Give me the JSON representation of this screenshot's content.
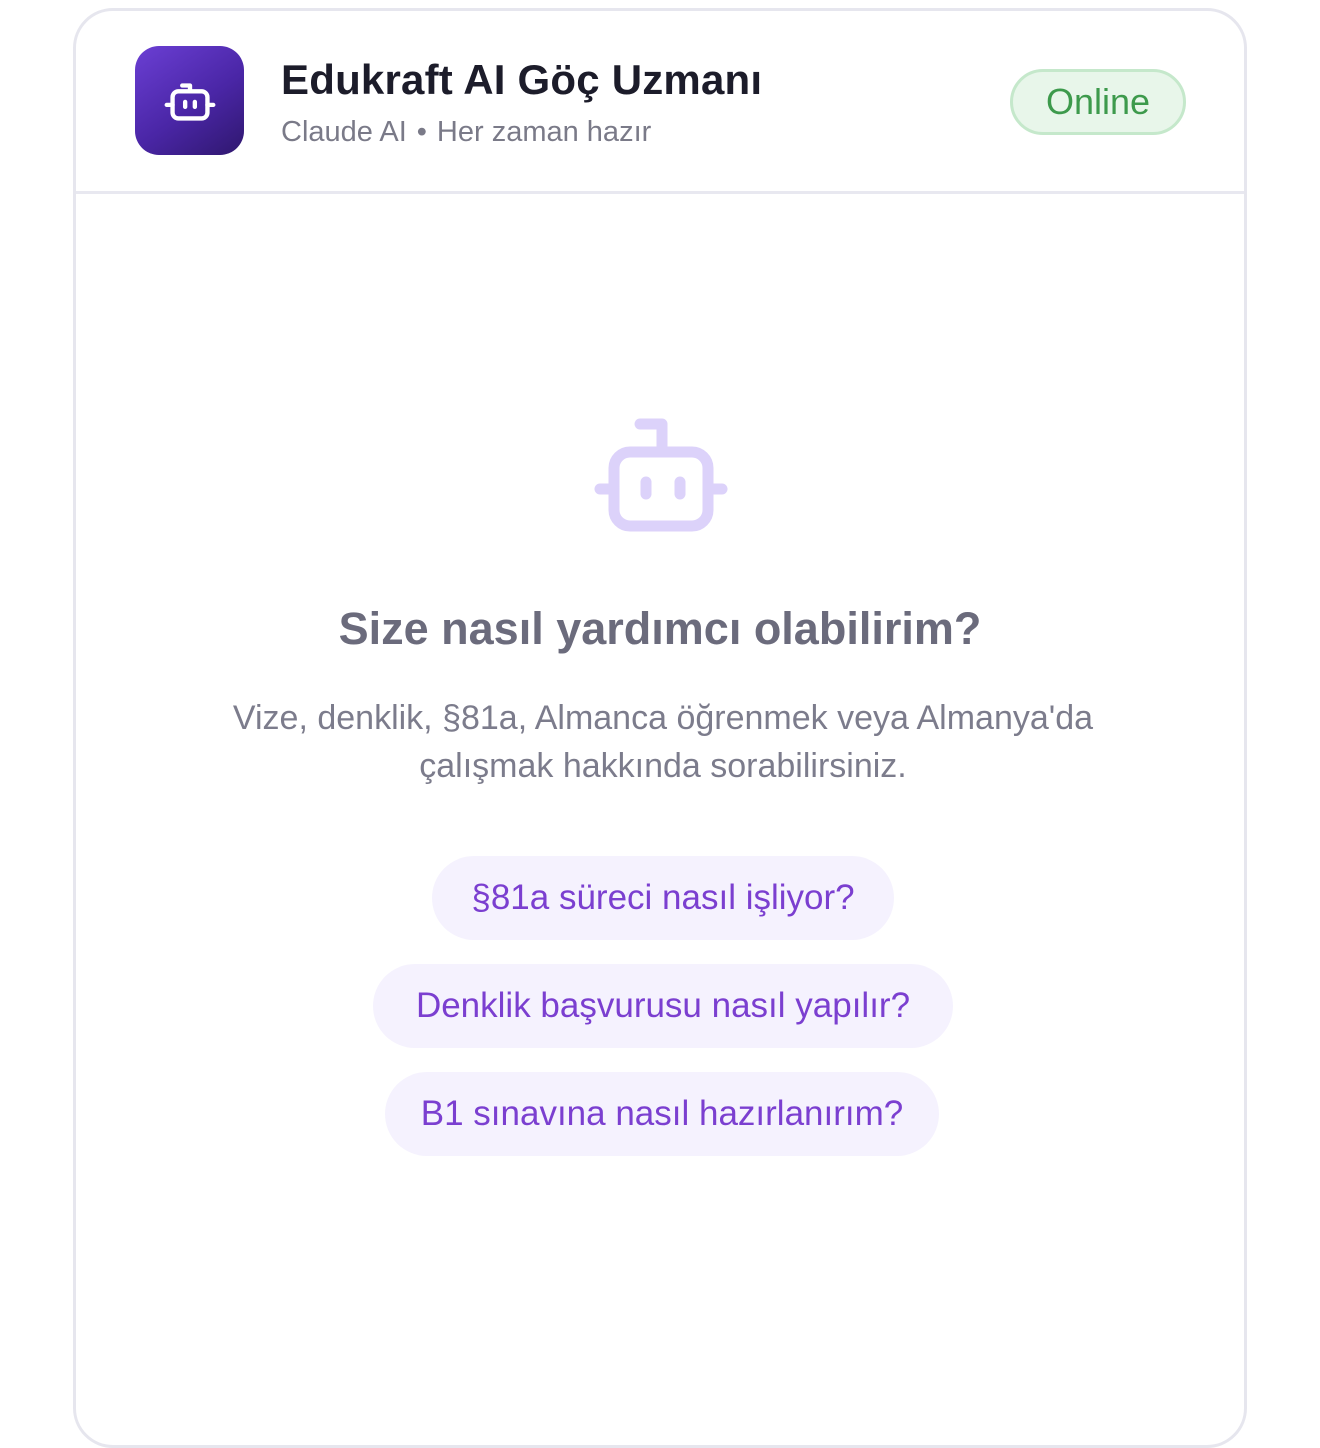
{
  "header": {
    "title": "Edukraft AI Göç Uzmanı",
    "provider": "Claude AI",
    "separator": "•",
    "tagline": "Her zaman hazır",
    "status": "Online",
    "app_icon": "robot-icon"
  },
  "welcome": {
    "icon": "robot-icon",
    "heading": "Size nasıl yardımcı olabilirim?",
    "description": "Vize, denklik, §81a, Almanca öğrenmek veya Almanya'da çalışmak hakkında sorabilirsiniz."
  },
  "suggestions": [
    {
      "label": "§81a süreci nasıl işliyor?"
    },
    {
      "label": "Denklik başvurusu nasıl yapılır?"
    },
    {
      "label": "B1 sınavına nasıl hazırlanırım?"
    }
  ],
  "colors": {
    "brand": "#5a2fc0",
    "status_bg": "#e8f6ea",
    "status_text": "#3d9a4c",
    "chip_bg": "#f5f2fe",
    "chip_text": "#7b3fd0"
  }
}
